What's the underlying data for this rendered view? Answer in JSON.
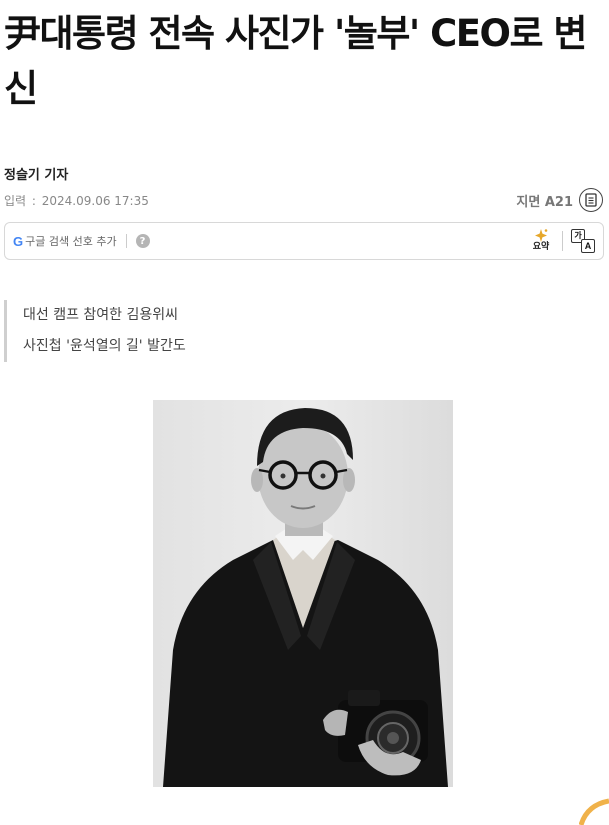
{
  "article": {
    "headline": "尹대통령 전속 사진가 '놀부' CEO로 변신",
    "reporter": "정슬기 기자",
    "date_label": "입력",
    "date_value": "2024.09.06 17:35",
    "page_ref": "지면 A21"
  },
  "toolbar": {
    "google_letter": "G",
    "google_pref_label": "구글 검색 선호 추가",
    "help_symbol": "?",
    "summary_label": "요약",
    "translate_top": "가",
    "translate_bottom": "A"
  },
  "subheadlines": [
    "대선 캠프 참여한 김용위씨",
    "사진첩 '윤석열의 길' 발간도"
  ],
  "icons": {
    "page_ref_icon": "document-icon",
    "help": "help-icon",
    "summary": "sparkle-icon",
    "translate": "translate-icon"
  },
  "colors": {
    "google_blue": "#4285f4",
    "summary_sparkle": "#e6a72a"
  }
}
